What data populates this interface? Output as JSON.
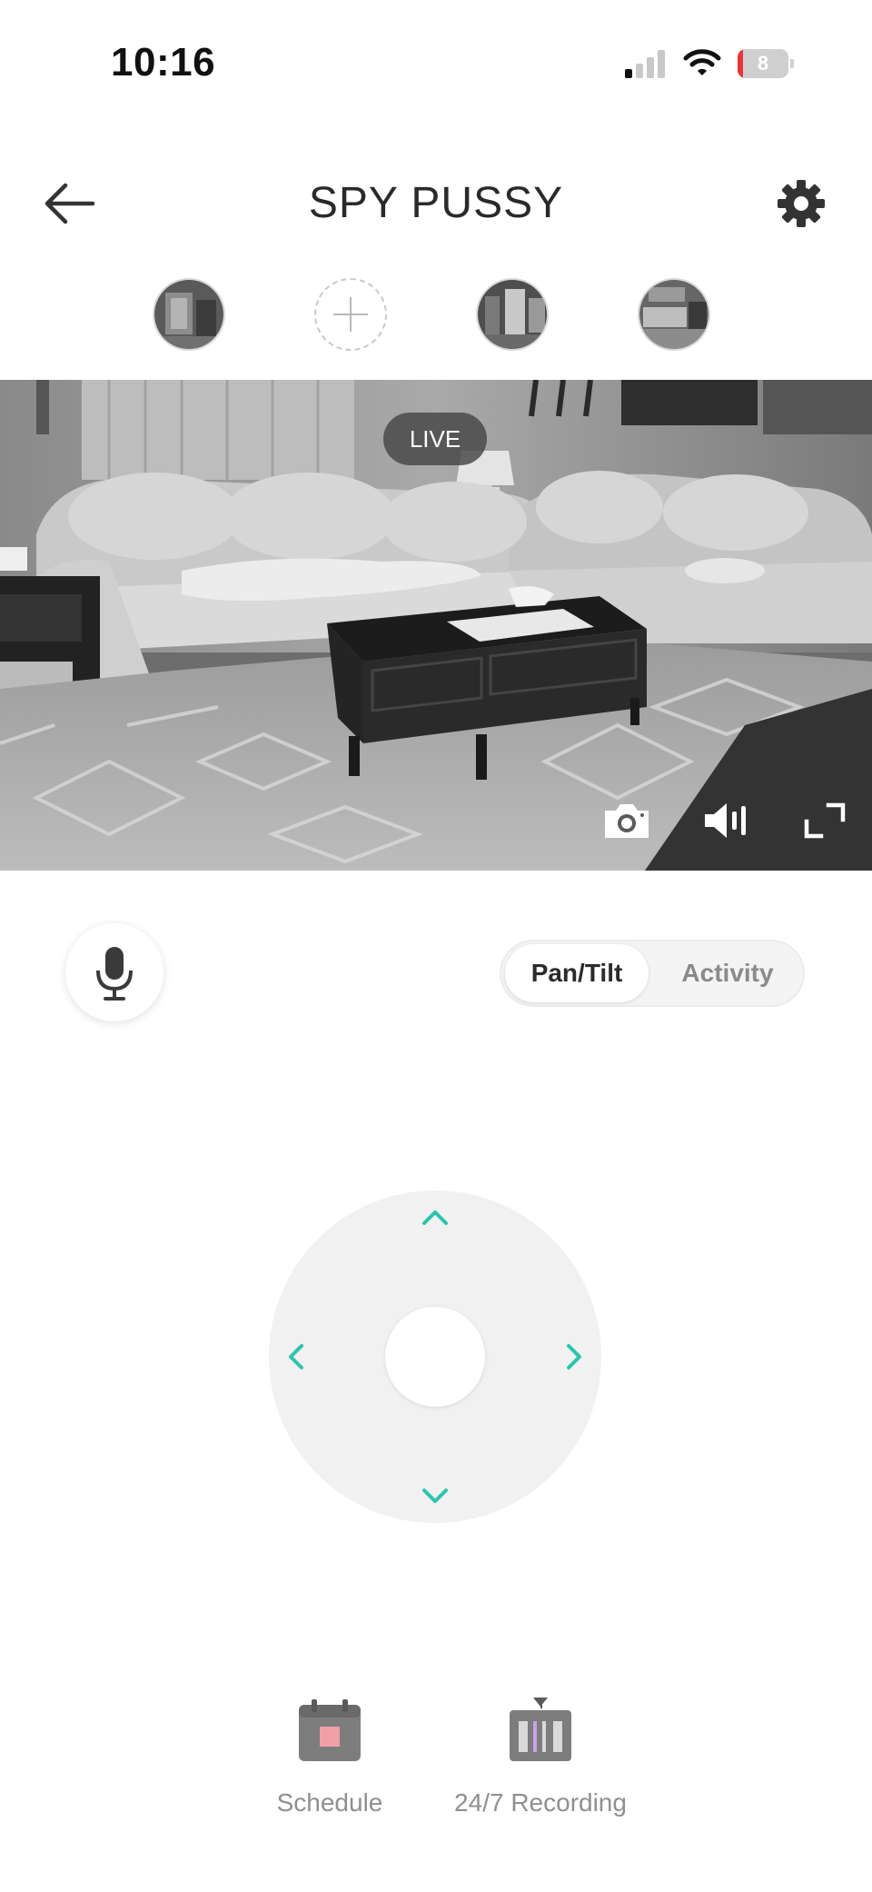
{
  "status_bar": {
    "time": "10:16",
    "battery_level": "8",
    "battery_fraction": 0.08,
    "battery_color": "#e8353a",
    "signal_bars_on": 1,
    "signal_bars_total": 4,
    "icons": [
      "cellular-signal-icon",
      "wifi-icon",
      "battery-icon"
    ]
  },
  "header": {
    "title": "SPY PUSSY",
    "back_icon": "arrow-left-icon",
    "settings_icon": "gear-icon"
  },
  "camera_switcher": {
    "items": [
      {
        "type": "camera",
        "icon": "camera-thumbnail"
      },
      {
        "type": "add",
        "icon": "plus-icon"
      },
      {
        "type": "camera",
        "icon": "camera-thumbnail"
      },
      {
        "type": "camera",
        "icon": "camera-thumbnail"
      }
    ]
  },
  "live_feed": {
    "badge": "LIVE",
    "controls": [
      "camera-snapshot-icon",
      "speaker-volume-icon",
      "fullscreen-icon"
    ]
  },
  "talk": {
    "icon": "microphone-icon"
  },
  "mode_toggle": {
    "tabs": [
      {
        "label": "Pan/Tilt",
        "active": true
      },
      {
        "label": "Activity",
        "active": false
      }
    ]
  },
  "joystick": {
    "accent_color": "#2cc4ad",
    "arrows": [
      "chevron-up-icon",
      "chevron-left-icon",
      "chevron-right-icon",
      "chevron-down-icon"
    ]
  },
  "bottom_actions": [
    {
      "label": "Schedule",
      "icon": "calendar-icon"
    },
    {
      "label": "24/7 Recording",
      "icon": "recording-timeline-icon"
    }
  ]
}
